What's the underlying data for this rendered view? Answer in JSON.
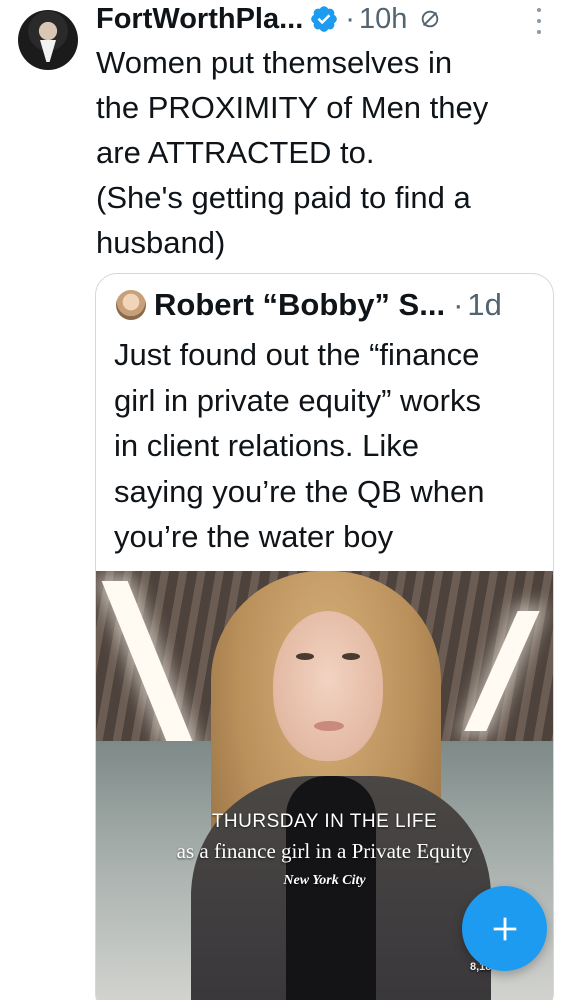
{
  "post": {
    "author": "FortWorthPla...",
    "separator": "·",
    "time": "10h",
    "text": "Women put themselves in\nthe PROXIMITY of Men they\nare ATTRACTED to.\n(She's getting paid to find a\nhusband)"
  },
  "quote": {
    "author": "Robert “Bobby” S...",
    "separator": "·",
    "time": "1d",
    "text": "Just found out the “finance\ngirl in private equity” works\nin client relations. Like\nsaying you’re the QB when\nyou’re the water boy",
    "media": {
      "overlay_title": "THURSDAY IN THE LIFE",
      "overlay_subtitle": "as a finance girl in a Private Equity",
      "overlay_city": "New York City",
      "view_count": "8,18"
    }
  },
  "icons": {
    "verified": "verified-badge-icon",
    "grok": "grok-icon",
    "more": "more-vertical-icon",
    "compose": "plus-icon"
  },
  "colors": {
    "accent": "#1d9bf0",
    "secondary_text": "#536471",
    "border": "#cfd9de"
  }
}
